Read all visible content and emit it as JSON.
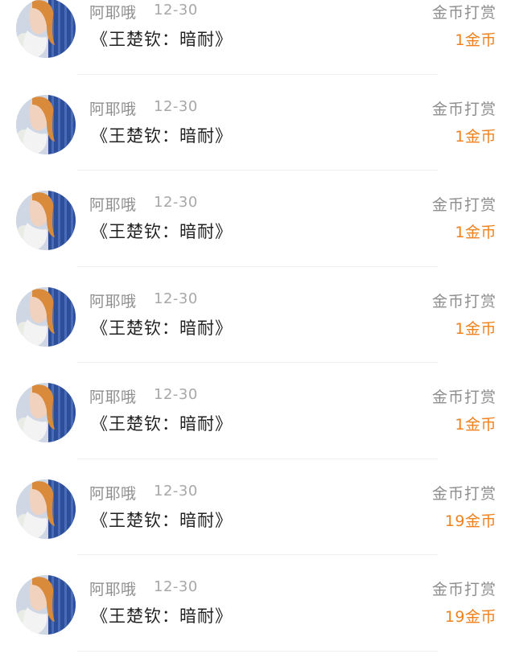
{
  "items": [
    {
      "name": "阿耶哦",
      "date": "12-30",
      "title": "《王楚钦：暗耐》",
      "action": "金币打赏",
      "amount": "1金币",
      "avatar": "avatar-photo"
    },
    {
      "name": "阿耶哦",
      "date": "12-30",
      "title": "《王楚钦：暗耐》",
      "action": "金币打赏",
      "amount": "1金币",
      "avatar": "avatar-photo"
    },
    {
      "name": "阿耶哦",
      "date": "12-30",
      "title": "《王楚钦：暗耐》",
      "action": "金币打赏",
      "amount": "1金币",
      "avatar": "avatar-photo"
    },
    {
      "name": "阿耶哦",
      "date": "12-30",
      "title": "《王楚钦：暗耐》",
      "action": "金币打赏",
      "amount": "1金币",
      "avatar": "avatar-photo"
    },
    {
      "name": "阿耶哦",
      "date": "12-30",
      "title": "《王楚钦：暗耐》",
      "action": "金币打赏",
      "amount": "1金币",
      "avatar": "avatar-photo"
    },
    {
      "name": "阿耶哦",
      "date": "12-30",
      "title": "《王楚钦：暗耐》",
      "action": "金币打赏",
      "amount": "19金币",
      "avatar": "avatar-photo"
    },
    {
      "name": "阿耶哦",
      "date": "12-30",
      "title": "《王楚钦：暗耐》",
      "action": "金币打赏",
      "amount": "19金币",
      "avatar": "avatar-photo"
    }
  ],
  "colors": {
    "amount": "#f0821e",
    "secondary_text": "#8e8e8e",
    "primary_text": "#222222"
  }
}
